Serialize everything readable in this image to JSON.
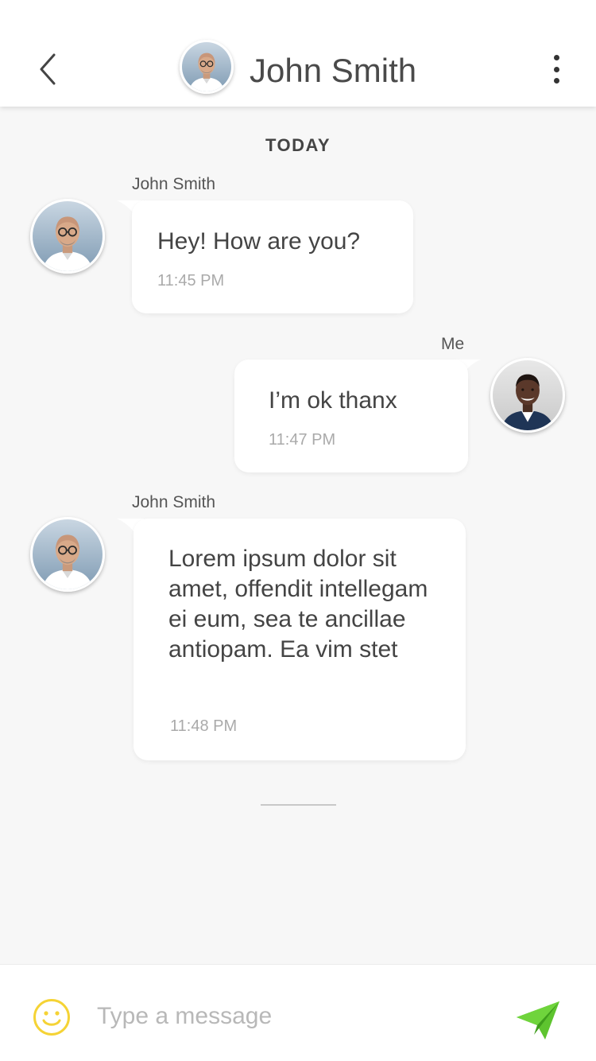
{
  "header": {
    "title": "John Smith",
    "back_icon": "chevron-left-icon",
    "more_icon": "more-vertical-icon"
  },
  "chat": {
    "day_label": "TODAY",
    "messages": [
      {
        "sender": "John Smith",
        "text": "Hey! How are you?",
        "time": "11:45 PM",
        "side": "left"
      },
      {
        "sender": "Me",
        "text": "I’m ok thanx",
        "time": "11:47 PM",
        "side": "right"
      },
      {
        "sender": "John Smith",
        "text": "Lorem ipsum dolor sit amet, offendit intellegam ei eum, sea te ancillae antiopam. Ea vim stet",
        "time": "11:48 PM",
        "side": "left"
      }
    ]
  },
  "composer": {
    "placeholder": "Type a message",
    "value": "",
    "emoji_icon": "smiley-icon",
    "send_icon": "paper-plane-icon"
  },
  "colors": {
    "background": "#f7f7f7",
    "bubble": "#ffffff",
    "send_accent": "#5ec42f",
    "emoji_accent": "#f5d335",
    "text": "#444444",
    "timestamp": "#aaaaaa"
  }
}
